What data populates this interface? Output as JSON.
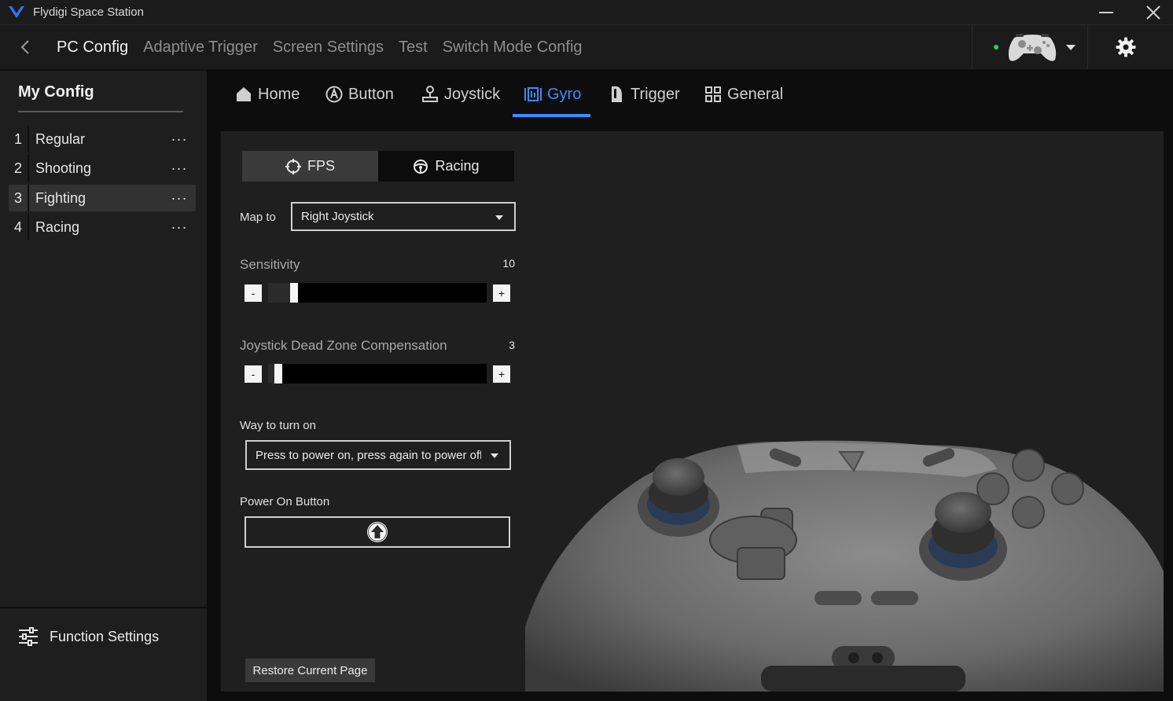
{
  "window": {
    "title": "Flydigi Space Station",
    "minimize": "—",
    "close": "✕"
  },
  "topnav": {
    "items": [
      {
        "label": "PC Config",
        "active": true
      },
      {
        "label": "Adaptive Trigger",
        "active": false
      },
      {
        "label": "Screen Settings",
        "active": false
      },
      {
        "label": "Test",
        "active": false
      },
      {
        "label": "Switch Mode Config",
        "active": false
      }
    ],
    "device_status_color": "#2ecc71"
  },
  "sidebar": {
    "title": "My Config",
    "configs": [
      {
        "index": "1",
        "name": "Regular",
        "more": "···"
      },
      {
        "index": "2",
        "name": "Shooting",
        "more": "···"
      },
      {
        "index": "3",
        "name": "Fighting",
        "more": "···"
      },
      {
        "index": "4",
        "name": "Racing",
        "more": "···"
      }
    ],
    "selected_index": 2,
    "function_settings": "Function Settings"
  },
  "tabs": [
    {
      "label": "Home",
      "icon": "home-icon"
    },
    {
      "label": "Button",
      "icon": "button-a-icon"
    },
    {
      "label": "Joystick",
      "icon": "joystick-icon"
    },
    {
      "label": "Gyro",
      "icon": "gyro-icon",
      "active": true
    },
    {
      "label": "Trigger",
      "icon": "trigger-icon"
    },
    {
      "label": "General",
      "icon": "grid-icon"
    }
  ],
  "accent_color": "#3a8dff",
  "gyro": {
    "modes": {
      "fps": "FPS",
      "racing": "Racing",
      "selected": "FPS"
    },
    "map_to": {
      "label": "Map to",
      "value": "Right Joystick"
    },
    "sensitivity": {
      "label": "Sensitivity",
      "value": "10",
      "level": 0.1,
      "minus": "-",
      "plus": "+"
    },
    "deadzone": {
      "label": "Joystick Dead Zone Compensation",
      "value": "3",
      "level": 0.03,
      "minus": "-",
      "plus": "+"
    },
    "way_to_turn_on": {
      "label": "Way to turn on",
      "value": "Press to power on, press again to power off"
    },
    "power_on_button": {
      "label": "Power On Button",
      "icon": "arrow-up-circle-icon"
    },
    "restore": "Restore Current Page"
  }
}
